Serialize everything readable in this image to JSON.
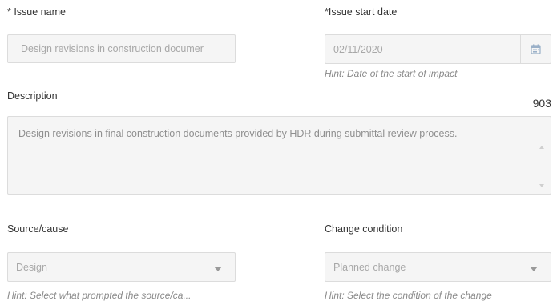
{
  "issue_name": {
    "label": "* Issue name",
    "value": "Design revisions in construction documer"
  },
  "issue_start_date": {
    "label": "*Issue start date",
    "value": "02/11/2020",
    "hint": "Hint: Date of the start of impact",
    "icon": "calendar-icon"
  },
  "description": {
    "label": "Description",
    "char_count": "903",
    "value": "Design revisions in final construction documents provided by HDR during submittal review process."
  },
  "source_cause": {
    "label": "Source/cause",
    "value": "Design",
    "hint": "Hint: Select what prompted the source/ca..."
  },
  "change_condition": {
    "label": "Change condition",
    "value": "Planned change",
    "hint": "Hint: Select the condition of the change"
  },
  "colors": {
    "field_bg": "#f5f5f5",
    "field_border": "#dcdcdc",
    "disabled_text": "#a8a8a8",
    "hint_text": "#8a8a8a",
    "label_text": "#333333"
  }
}
